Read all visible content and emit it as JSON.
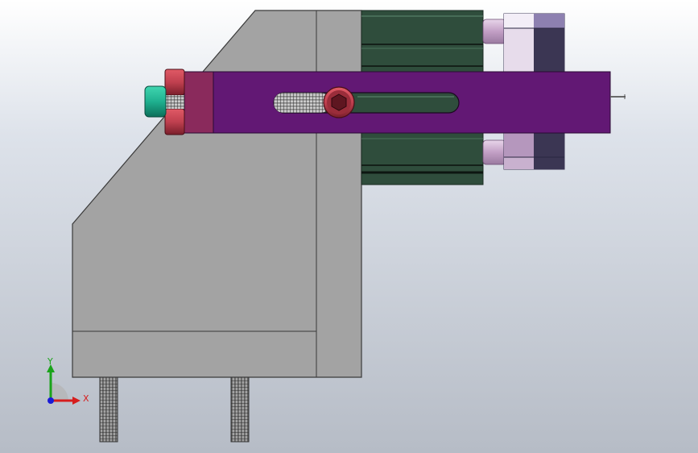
{
  "viewport": {
    "colors": {
      "background_top": "#ffffff",
      "background_bottom": "#b6bcc6",
      "bracket": "#a3a3a3",
      "bracket_edge": "#3a3a3a",
      "cylinder_body": "#2f4d3c",
      "slide_plate": "#621874",
      "end_plate": "#8a2a5c",
      "bolt_head": "#c0404f",
      "stopper": "#1fb08f",
      "rod": "#c7a9c7",
      "end_block_light": "#d9c3e0",
      "end_block_dark": "#3b3653"
    }
  },
  "triad": {
    "y_label": "Y",
    "x_label": "X",
    "x_color": "#d61d1d",
    "y_color": "#1aa31a",
    "z_color": "#1a1ad6"
  }
}
